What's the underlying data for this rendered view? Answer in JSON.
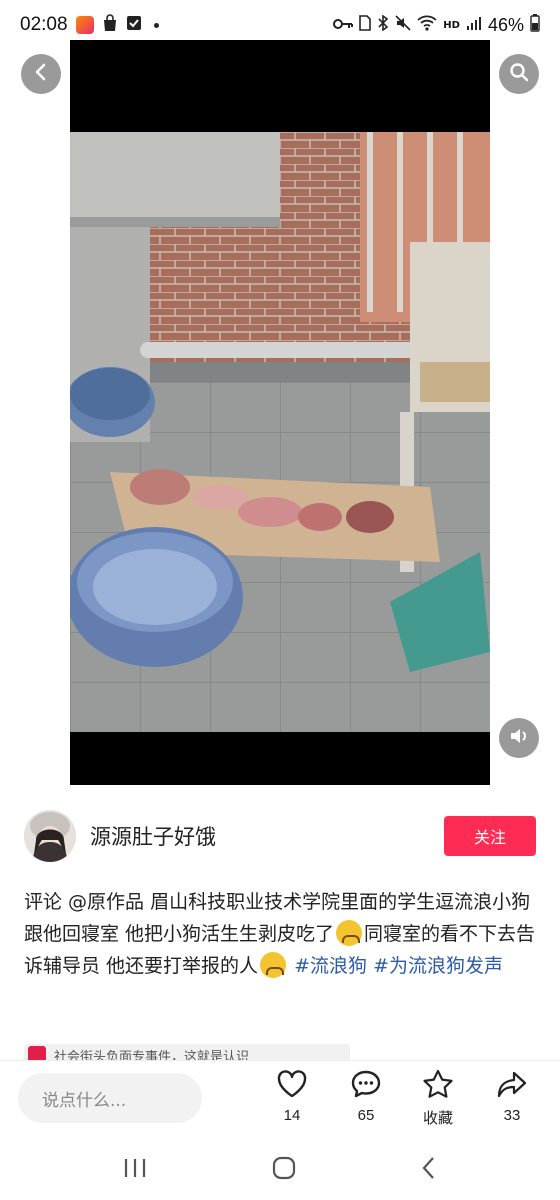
{
  "status_bar": {
    "time": "02:08",
    "battery": "46%",
    "network": "HD"
  },
  "media": {
    "back_icon": "chevron-left-icon",
    "search_icon": "search-icon",
    "sound_icon": "speaker-icon"
  },
  "author": {
    "name": "源源肚子好饿",
    "follow_label": "关注"
  },
  "description": {
    "text1": "评论 @原作品 眉山科技职业技术学院里面的学生逗流浪小狗跟他回寝室 他把小狗活生生剥皮吃了",
    "text2": "同寝室的看不下去告诉辅导员 他还要打举报的人",
    "tag1": "#流浪狗",
    "tag2": "#为流浪狗发声"
  },
  "related": {
    "text": "社会街头负面专事件，这就是认识"
  },
  "bottom_bar": {
    "comment_placeholder": "说点什么...",
    "like_count": "14",
    "comment_count": "65",
    "favorite_label": "收藏",
    "share_count": "33"
  },
  "colors": {
    "accent": "#fe2c55",
    "tag": "#2c5ba8"
  }
}
